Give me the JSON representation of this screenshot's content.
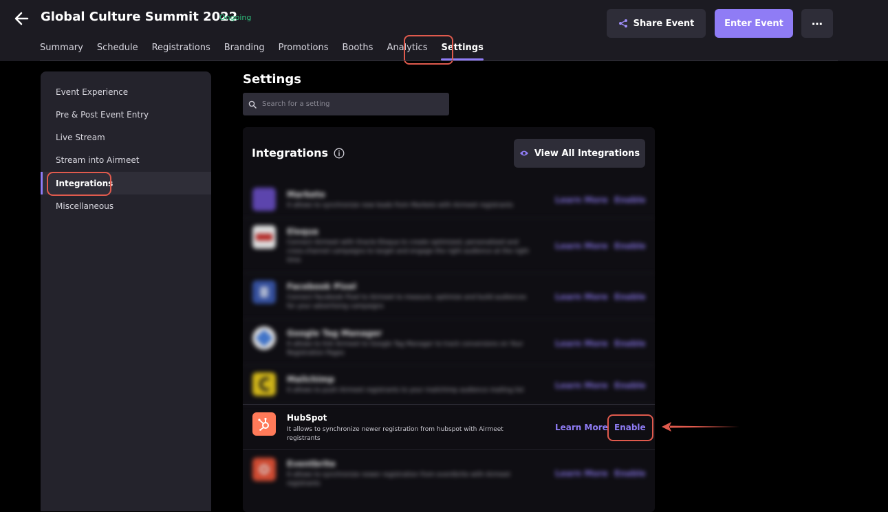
{
  "header": {
    "title": "Global Culture Summit 2022",
    "status": "Ongoing",
    "share_label": "Share Event",
    "enter_label": "Enter Event",
    "more_label": "⋯"
  },
  "tabs": [
    {
      "label": "Summary"
    },
    {
      "label": "Schedule"
    },
    {
      "label": "Registrations"
    },
    {
      "label": "Branding"
    },
    {
      "label": "Promotions"
    },
    {
      "label": "Booths"
    },
    {
      "label": "Analytics"
    },
    {
      "label": "Settings"
    }
  ],
  "sidebar": {
    "items": [
      {
        "label": "Event Experience"
      },
      {
        "label": "Pre & Post Event Entry"
      },
      {
        "label": "Live Stream"
      },
      {
        "label": "Stream into Airmeet"
      },
      {
        "label": "Integrations"
      },
      {
        "label": "Miscellaneous"
      }
    ]
  },
  "settings": {
    "title": "Settings",
    "search_placeholder": "Search for a setting"
  },
  "integrations": {
    "heading": "Integrations",
    "view_all_label": "View All Integrations",
    "items": [
      {
        "name": "Marketo",
        "description": "It allows to synchronize new leads from Marketo with Airmeet registrants",
        "learn_more": "Learn More",
        "enable": "Enable",
        "color": "#6a4fc8"
      },
      {
        "name": "Eloqua",
        "description": "Connect Airmeet with Oracle Eloqua to create optimized, personalized and cross-channel campaigns to target and engage the right audience at the right time",
        "learn_more": "Learn More",
        "enable": "Enable",
        "color": "#ffffff"
      },
      {
        "name": "Facebook Pixel",
        "description": "Connect Facebook Pixel to Airmeet to measure, optimize and build audiences for your advertising campaigns",
        "learn_more": "Learn More",
        "enable": "Enable",
        "color": "#3b5bb5"
      },
      {
        "name": "Google Tag Manager",
        "description": "It allows to link Airmeet to Google Tag Manager to track conversions on Your Registration Pages",
        "learn_more": "Learn More",
        "enable": "Enable",
        "color": "#4a86e8"
      },
      {
        "name": "Mailchimp",
        "description": "It allows to push Airmeet registrants to your mailchimp audience mailing list",
        "learn_more": "Learn More",
        "enable": "Enable",
        "color": "#f2d21a"
      },
      {
        "name": "HubSpot",
        "description": "It allows to synchronize newer registration from hubspot with Airmeet registrants",
        "learn_more": "Learn More",
        "enable": "Enable",
        "color": "#ff7a59"
      },
      {
        "name": "Eventbrite",
        "description": "It allows to synchronize newer registration from eventbrite with Airmeet registrants",
        "learn_more": "Learn More",
        "enable": "Enable",
        "color": "#f05537"
      }
    ]
  }
}
